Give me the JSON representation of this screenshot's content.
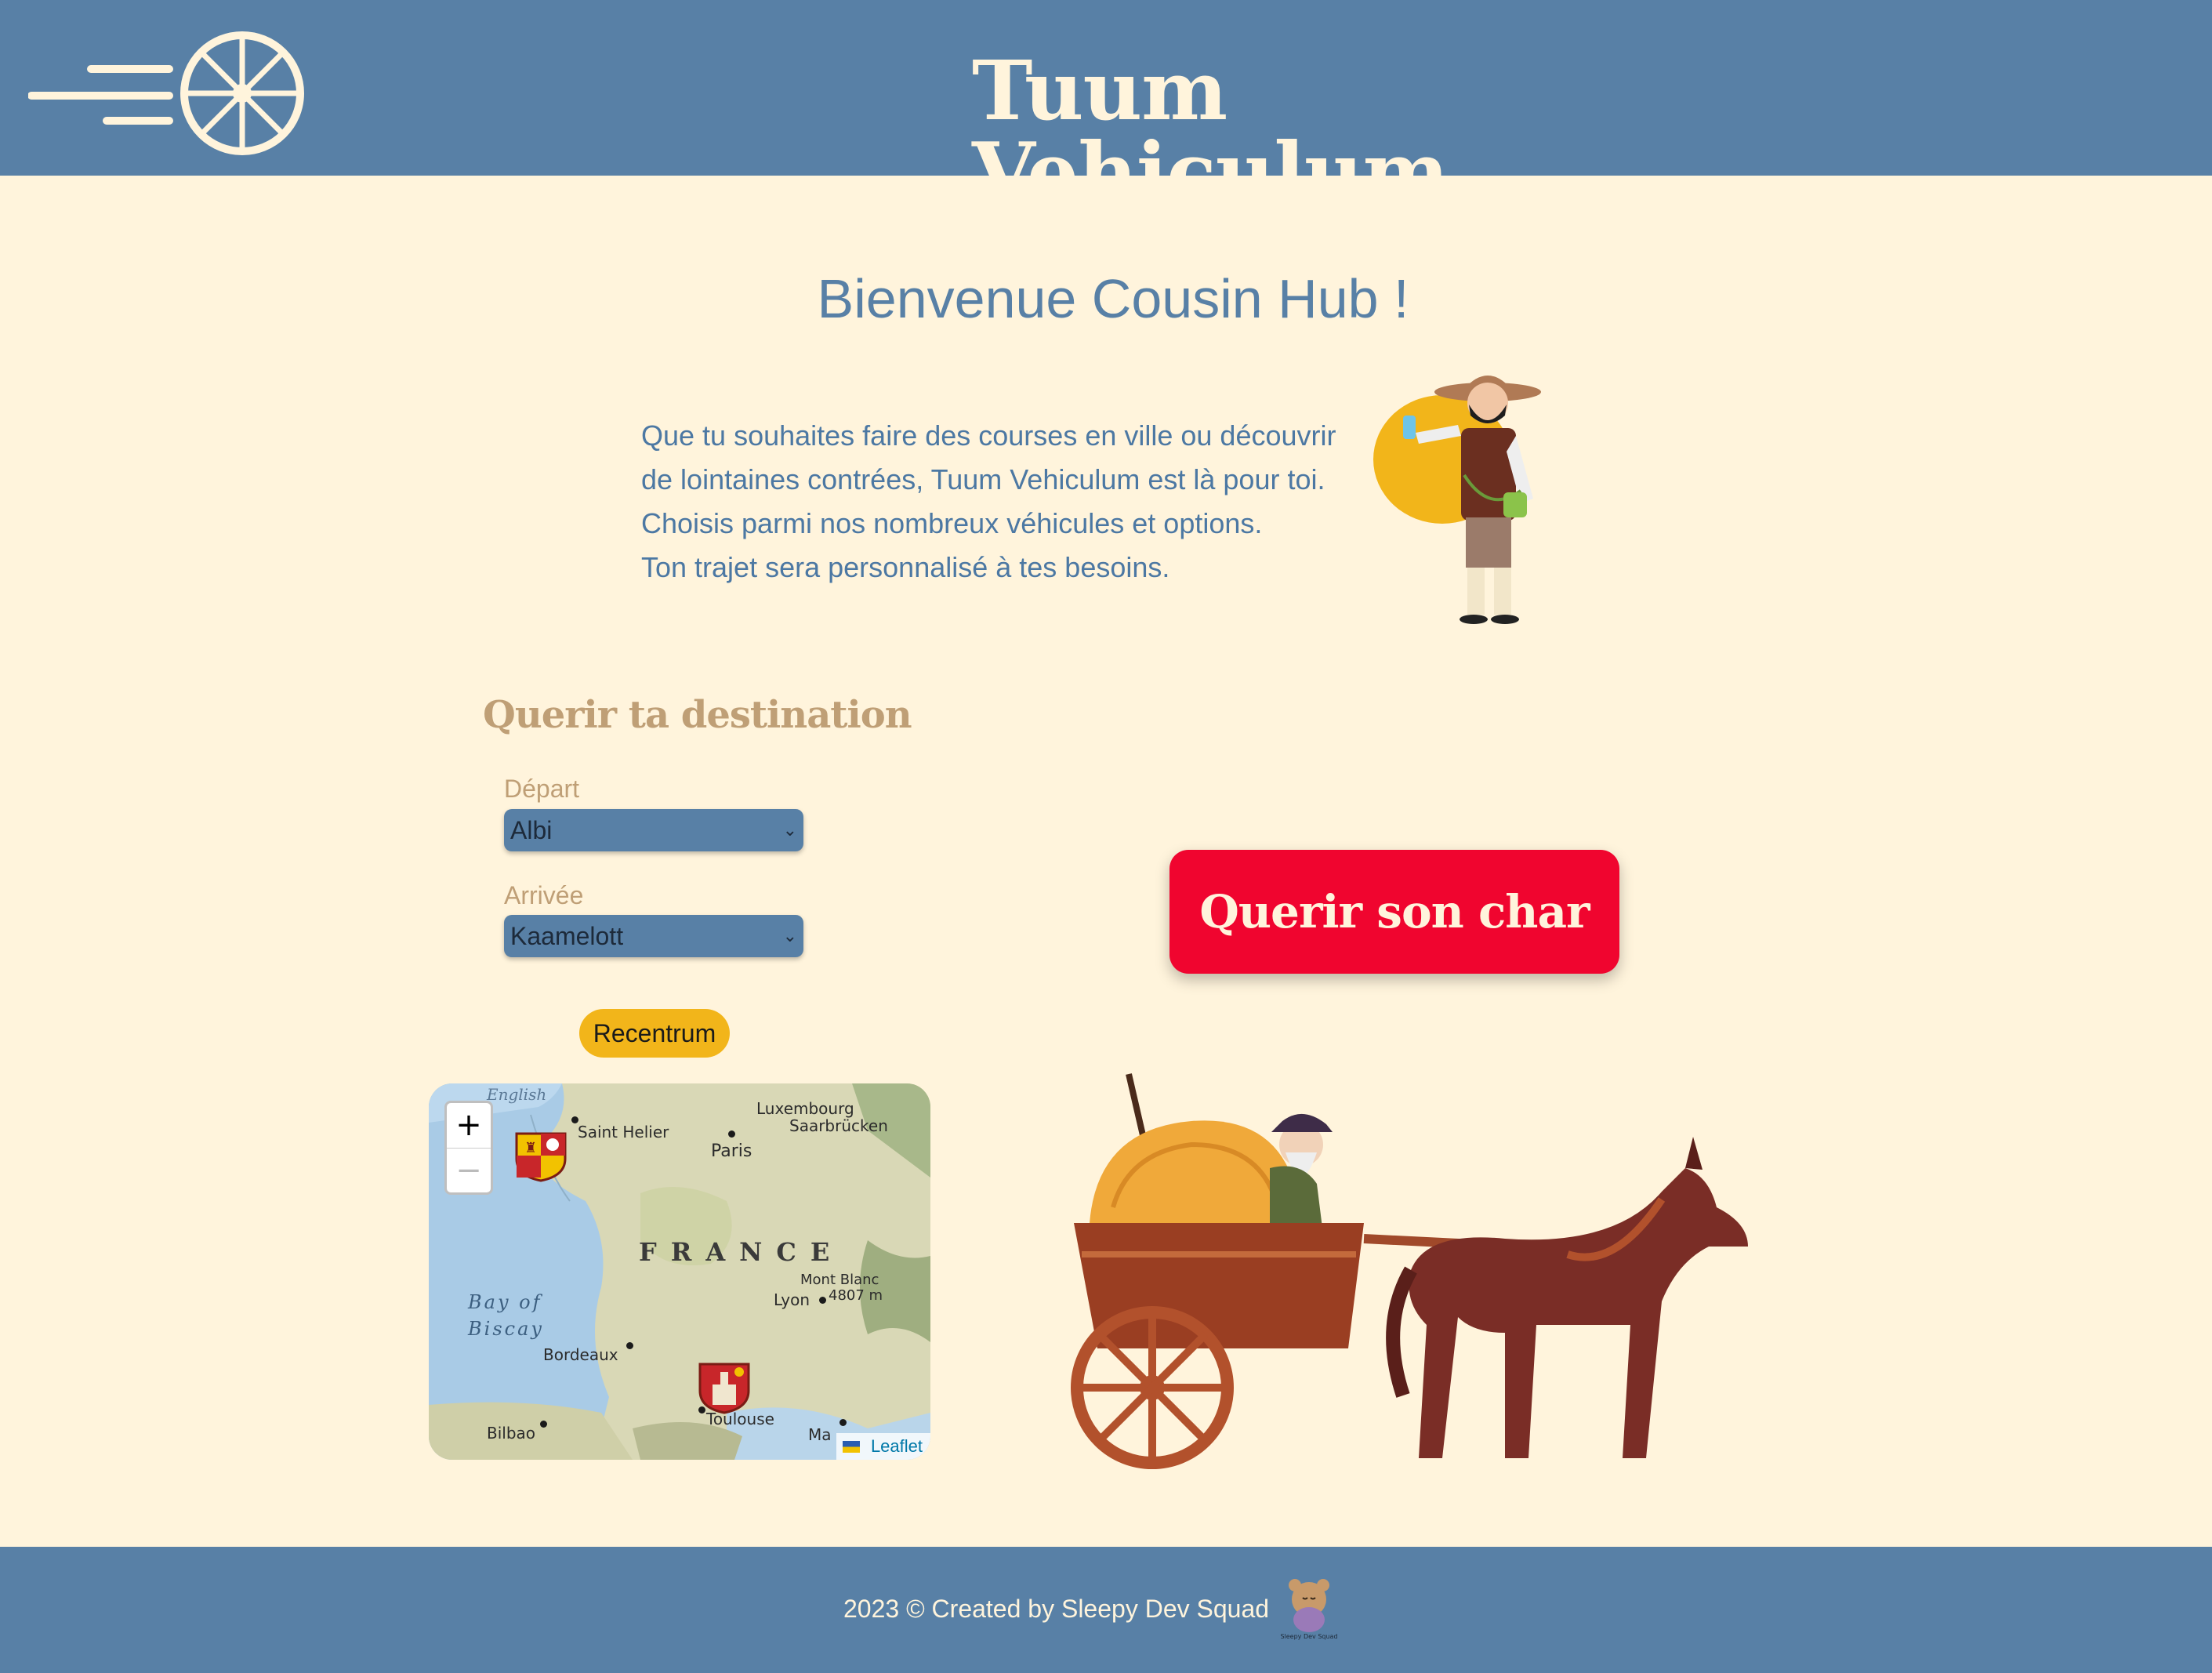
{
  "header": {
    "title": "Tuum Vehiculum",
    "logo_icon": "wagon-wheel-speed-icon"
  },
  "welcome": {
    "title": "Bienvenue Cousin Hub !",
    "lines": [
      "Que tu souhaites faire des courses en ville ou découvrir",
      "de lointaines contrées, Tuum Vehiculum est là pour toi.",
      "Choisis parmi nos nombreux véhicules et options.",
      "Ton trajet sera personnalisé à tes besoins."
    ]
  },
  "form": {
    "title": "Querir ta destination",
    "depart_label": "Départ",
    "depart_value": "Albi",
    "arrivee_label": "Arrivée",
    "arrivee_value": "Kaamelott",
    "recenter_label": "Recentrum"
  },
  "map": {
    "zoom_in": "+",
    "zoom_out": "−",
    "country": "FRANCE",
    "sea_line1": "Bay of",
    "sea_line2": "Biscay",
    "top_water": "English",
    "places": {
      "saint_helier": "Saint Helier",
      "paris": "Paris",
      "luxembourg": "Luxembourg",
      "saarbrucken": "Saarbrücken",
      "mont_blanc": "Mont Blanc",
      "mont_blanc_alt": "4807 m",
      "lyon": "Lyon",
      "bordeaux": "Bordeaux",
      "toulouse": "Toulouse",
      "bilbao": "Bilbao",
      "marseille": "Ma"
    },
    "attribution": "Leaflet"
  },
  "cta": {
    "label": "Querir son char"
  },
  "footer": {
    "text": "2023 © Created by Sleepy Dev Squad",
    "logo_caption": "Sleepy Dev Squad"
  },
  "colors": {
    "primary": "#5880a6",
    "background": "#fff4dc",
    "accent_red": "#f0052f",
    "accent_yellow": "#f2b51a",
    "label_tan": "#bf9f76"
  }
}
